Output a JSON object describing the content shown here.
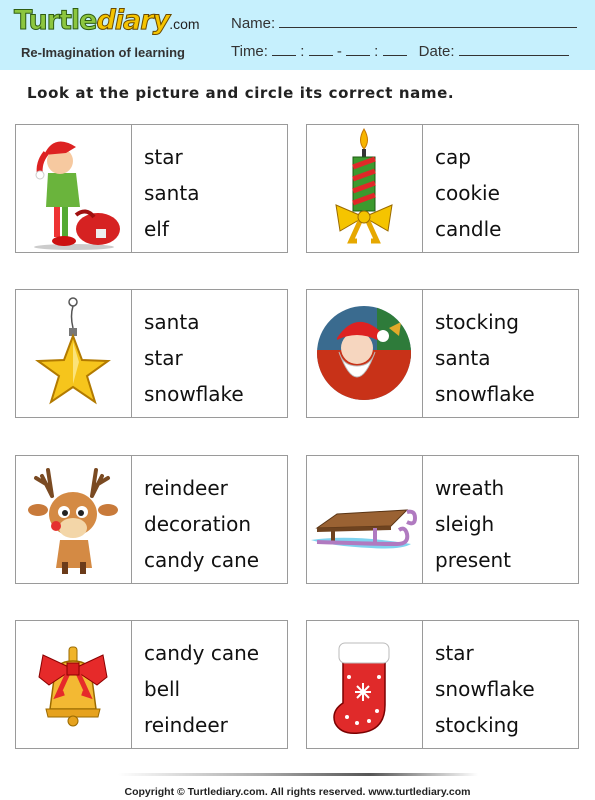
{
  "header": {
    "logo_part1": "Turtle",
    "logo_part2": "diary",
    "logo_suffix": ".com",
    "tagline": "Re-Imagination of learning",
    "name_label": "Name:",
    "time_label": "Time:",
    "time_sep1": ":",
    "time_sep2": "-",
    "time_sep3": ":",
    "date_label": "Date:"
  },
  "instruction": "Look at the picture and circle its correct name.",
  "cards": [
    {
      "picture": "elf",
      "options": [
        "star",
        "santa",
        "elf"
      ]
    },
    {
      "picture": "candle",
      "options": [
        "cap",
        "cookie",
        "candle"
      ]
    },
    {
      "picture": "star",
      "options": [
        "santa",
        "star",
        "snowflake"
      ]
    },
    {
      "picture": "santa",
      "options": [
        "stocking",
        "santa",
        "snowflake"
      ]
    },
    {
      "picture": "reindeer",
      "options": [
        "reindeer",
        "decoration",
        "candy cane"
      ]
    },
    {
      "picture": "sleigh",
      "options": [
        "wreath",
        "sleigh",
        "present"
      ]
    },
    {
      "picture": "bell",
      "options": [
        "candy cane",
        "bell",
        "reindeer"
      ]
    },
    {
      "picture": "stocking",
      "options": [
        "star",
        "snowflake",
        "stocking"
      ]
    }
  ],
  "footer": "Copyright © Turtlediary.com. All rights reserved. www.turtlediary.com"
}
